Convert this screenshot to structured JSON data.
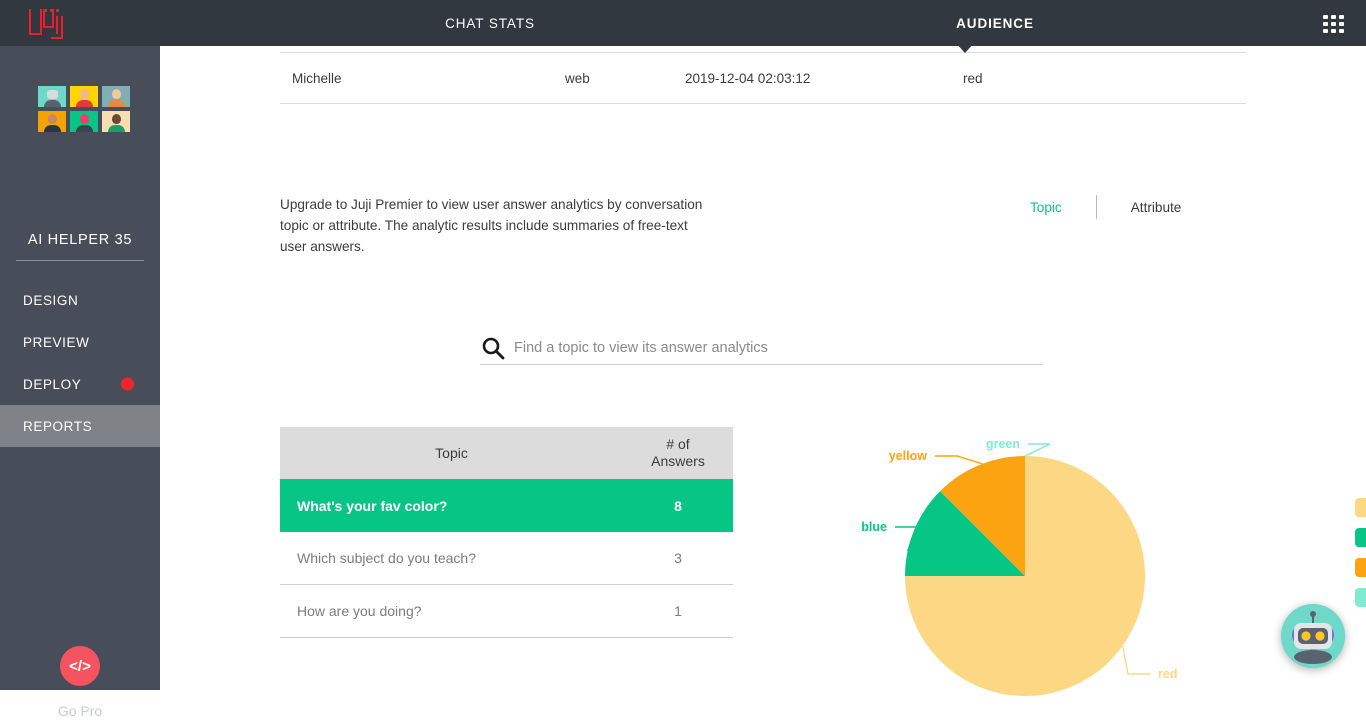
{
  "header": {
    "logo_alt": "juji-logo",
    "tabs": [
      {
        "label": "CHAT STATS",
        "active": false
      },
      {
        "label": "AUDIENCE",
        "active": true
      }
    ],
    "apps_icon": "grid-apps-icon"
  },
  "sidebar": {
    "bot_name": "AI HELPER 35",
    "avatars_icon": "audience-avatars",
    "items": [
      {
        "label": "DESIGN",
        "active": false,
        "badge": false
      },
      {
        "label": "PREVIEW",
        "active": false,
        "badge": false
      },
      {
        "label": "DEPLOY",
        "active": false,
        "badge": true
      },
      {
        "label": "REPORTS",
        "active": true,
        "badge": false
      }
    ],
    "gopro": {
      "icon": "code-icon",
      "icon_glyph": "</>",
      "label": "Go Pro"
    }
  },
  "user_table": {
    "row": {
      "name": "Michelle",
      "channel": "web",
      "timestamp": "2019-12-04 02:03:12",
      "answer": "red"
    }
  },
  "upgrade": {
    "text": "Upgrade to Juji Premier to view user answer analytics by conversation topic or attribute. The analytic results include summaries of free-text user answers."
  },
  "segmented": {
    "options": [
      {
        "label": "Topic",
        "active": true
      },
      {
        "label": "Attribute",
        "active": false
      }
    ],
    "active_color": "#06C585"
  },
  "search": {
    "icon": "search-icon",
    "placeholder": "Find a topic to view its answer analytics",
    "value": ""
  },
  "topic_table": {
    "columns": [
      "Topic",
      "# of Answers"
    ],
    "col_topic": "Topic",
    "col_count_line1": "# of",
    "col_count_line2": "Answers",
    "rows": [
      {
        "topic": "What's your fav color?",
        "answers": "8",
        "selected": true
      },
      {
        "topic": "Which subject do you teach?",
        "answers": "3",
        "selected": false
      },
      {
        "topic": "How are you doing?",
        "answers": "1",
        "selected": false
      }
    ]
  },
  "chart_data": {
    "type": "pie",
    "title": "What's your fav color?",
    "labels": [
      "red",
      "blue",
      "yellow",
      "green"
    ],
    "values": [
      6,
      1,
      1,
      0
    ],
    "percentages": [
      75,
      12.5,
      12.5,
      0
    ],
    "colors": [
      "#FCD884",
      "#06C585",
      "#FCA311",
      "#7FEBD2"
    ],
    "total": 8,
    "legend_position": "right",
    "leader_labels": [
      {
        "label": "red",
        "color": "#FCD884"
      },
      {
        "label": "blue",
        "color": "#06C585"
      },
      {
        "label": "yellow",
        "color": "#FCA311"
      },
      {
        "label": "green",
        "color": "#7FEBD2"
      }
    ],
    "start_angle": -90,
    "direction": "clockwise"
  },
  "bot_fab": {
    "icon": "robot-avatar-icon"
  }
}
